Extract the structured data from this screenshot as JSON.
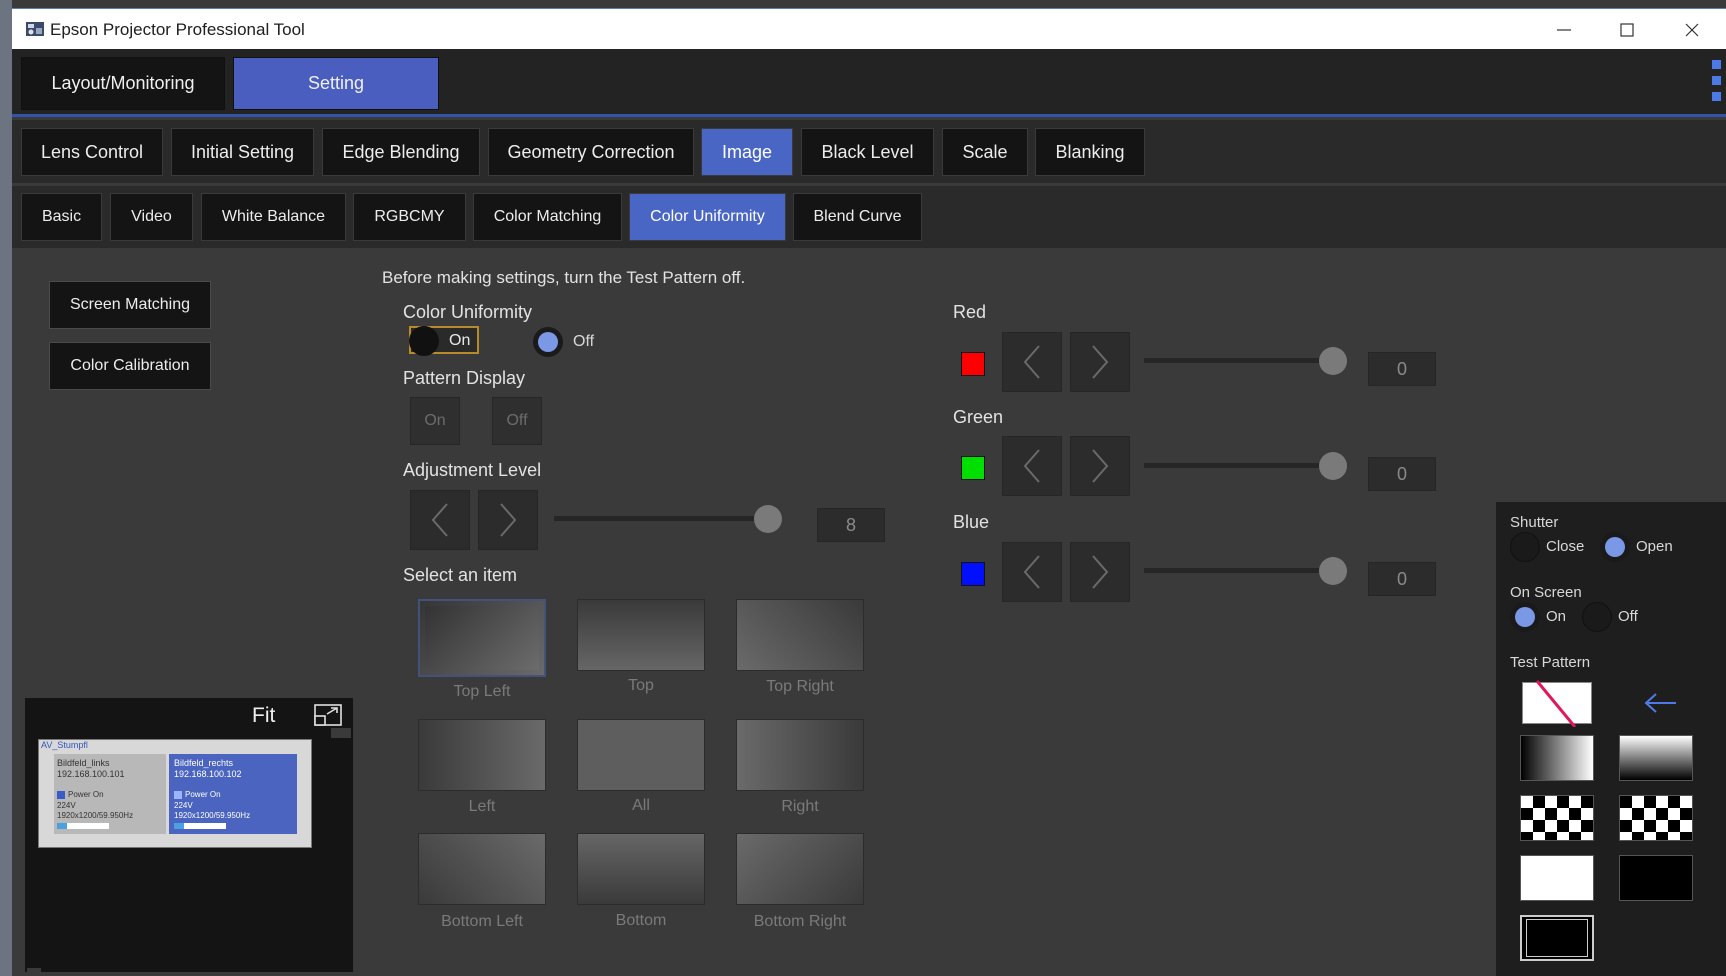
{
  "window": {
    "title": "Epson Projector Professional Tool"
  },
  "mode_tabs": [
    {
      "label": "Layout/Monitoring",
      "active": false
    },
    {
      "label": "Setting",
      "active": true
    }
  ],
  "category_tabs": [
    {
      "label": "Lens Control"
    },
    {
      "label": "Initial Setting"
    },
    {
      "label": "Edge Blending"
    },
    {
      "label": "Geometry Correction"
    },
    {
      "label": "Image",
      "active": true
    },
    {
      "label": "Black Level"
    },
    {
      "label": "Scale"
    },
    {
      "label": "Blanking"
    }
  ],
  "sub_tabs": [
    {
      "label": "Basic"
    },
    {
      "label": "Video"
    },
    {
      "label": "White Balance"
    },
    {
      "label": "RGBCMY"
    },
    {
      "label": "Color Matching"
    },
    {
      "label": "Color Uniformity",
      "active": true
    },
    {
      "label": "Blend Curve"
    }
  ],
  "side_buttons": {
    "screen_matching": "Screen Matching",
    "color_calibration": "Color Calibration"
  },
  "notice": "Before making settings, turn the Test Pattern off.",
  "color_uniformity": {
    "label": "Color Uniformity",
    "on_label": "On",
    "off_label": "Off",
    "selected": "Off"
  },
  "pattern_display": {
    "label": "Pattern Display",
    "on_label": "On",
    "off_label": "Off"
  },
  "adjustment_level": {
    "label": "Adjustment Level",
    "value": "8",
    "fraction": 1.0
  },
  "select_item": {
    "label": "Select an item",
    "items": [
      "Top Left",
      "Top",
      "Top Right",
      "Left",
      "All",
      "Right",
      "Bottom Left",
      "Bottom",
      "Bottom Right"
    ],
    "selected": "Top Left"
  },
  "rgb": [
    {
      "label": "Red",
      "value": "0",
      "color": "#ff0000"
    },
    {
      "label": "Green",
      "value": "0",
      "color": "#00e000"
    },
    {
      "label": "Blue",
      "value": "0",
      "color": "#0010ff"
    }
  ],
  "preview": {
    "fit_label": "Fit",
    "group_name": "AV_Stumpfl",
    "projectors": [
      {
        "name": "Bildfeld_links",
        "ip": "192.168.100.101",
        "status": "Power On",
        "voltage": "224V",
        "signal": "1920x1200/59.950Hz",
        "selected": false
      },
      {
        "name": "Bildfeld_rechts",
        "ip": "192.168.100.102",
        "status": "Power On",
        "voltage": "224V",
        "signal": "1920x1200/59.950Hz",
        "selected": true
      }
    ]
  },
  "right_panel": {
    "shutter": {
      "label": "Shutter",
      "close_label": "Close",
      "open_label": "Open",
      "selected": "Open"
    },
    "on_screen": {
      "label": "On Screen",
      "on_label": "On",
      "off_label": "Off",
      "selected": "On"
    },
    "test_pattern": {
      "label": "Test Pattern"
    }
  },
  "colors": {
    "accent": "#4a66c4",
    "accent_mode": "#4a5ec0",
    "kebab": "#4e7ae8"
  }
}
